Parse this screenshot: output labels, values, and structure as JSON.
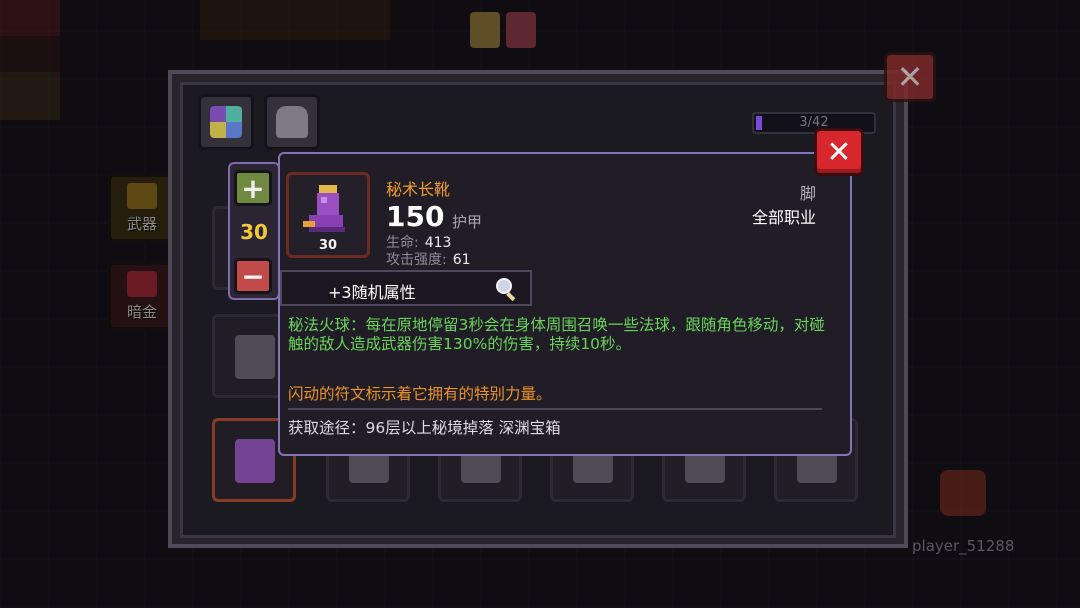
{
  "scene": {
    "player_name": "player_51288"
  },
  "sidebar": {
    "items": [
      {
        "label": "武器",
        "icon": "sword-icon",
        "color": "#8f6e1e"
      },
      {
        "label": "暗金",
        "icon": "gem-icon",
        "color": "#a2283a"
      }
    ]
  },
  "panel": {
    "capacity": "3/42",
    "tabs": [
      {
        "icon": "grid-icon"
      },
      {
        "icon": "helmet-icon"
      }
    ],
    "close_glyph": "✕"
  },
  "quantity": {
    "plus": "+",
    "minus": "−",
    "value": "30"
  },
  "tooltip": {
    "close_glyph": "✕",
    "item_name": "秘术长靴",
    "item_count": "30",
    "armor_value": "150",
    "armor_label": "护甲",
    "stats": [
      {
        "label": "生命:",
        "value": "413"
      },
      {
        "label": "攻击强度:",
        "value": "61"
      }
    ],
    "slot_type": "脚",
    "class_restriction": "全部职业",
    "random_attr_label": "+3随机属性",
    "effect_text": "秘法火球：每在原地停留3秒会在身体周围召唤一些法球，跟随角色移动，对碰触的敌人造成武器伤害130%的伤害，持续10秒。",
    "flavor_text": "闪动的符文标示着它拥有的特别力量。",
    "source_text": "获取途径：96层以上秘境掉落 深渊宝箱",
    "colors": {
      "name": "#ef9c2a",
      "effect": "#69d35a",
      "flavor": "#ea9228",
      "border": "#8274b6",
      "close": "#d8272c"
    }
  }
}
